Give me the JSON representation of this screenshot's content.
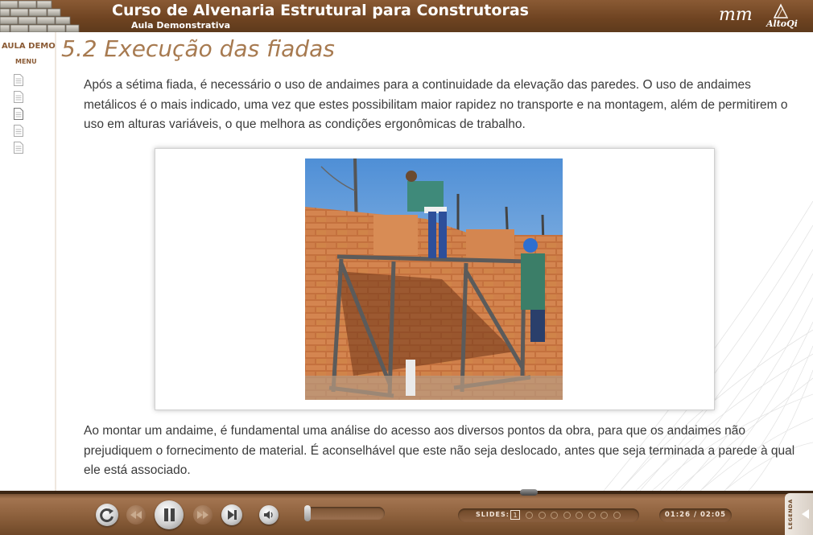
{
  "header": {
    "course_title": "Curso de Alvenaria Estrutural para Construtoras",
    "subtitle": "Aula Demonstrativa",
    "logo_left_text": "mm",
    "logo_right_text": "AltoQi"
  },
  "sidebar": {
    "aula_label": "AULA DEMO",
    "menu_label": "MENU",
    "items": [
      {
        "icon": "page-icon",
        "active": false
      },
      {
        "icon": "page-icon",
        "active": false
      },
      {
        "icon": "page-icon",
        "active": true
      },
      {
        "icon": "page-icon",
        "active": false
      },
      {
        "icon": "page-icon",
        "active": false
      }
    ]
  },
  "main": {
    "title": "5.2 Execução das fiadas",
    "paragraph1": "Após a sétima fiada, é necessário o uso de andaimes para a continuidade da elevação das paredes. O uso de andaimes metálicos é o mais indicado, uma vez que estes possibilitam maior rapidez no transporte e na montagem, além de permitirem o uso em alturas variáveis, o que melhora as condições ergonômicas de trabalho.",
    "paragraph2": "Ao montar um andaime, é fundamental uma análise do acesso aos diversos pontos da obra, para que os andaimes não prejudiquem o fornecimento de material. É aconselhável que este não seja deslocado, antes que seja terminada a parede à qual ele está associado.",
    "photo": "workers on metal scaffolding building a ceramic block wall"
  },
  "player": {
    "progress": 0.65,
    "slides_label": "SLIDES:",
    "current_slide": "1",
    "total_slides": 9,
    "time": "01:26 / 02:05",
    "legenda_label": "LEGENDA",
    "icons": [
      "replay-icon",
      "rewind-icon",
      "pause-icon",
      "forward-icon",
      "skip-end-icon",
      "volume-icon"
    ]
  },
  "colors": {
    "header_brown": "#6e4321",
    "title_brown": "#a77a50",
    "body_text": "#3a3a3a"
  }
}
